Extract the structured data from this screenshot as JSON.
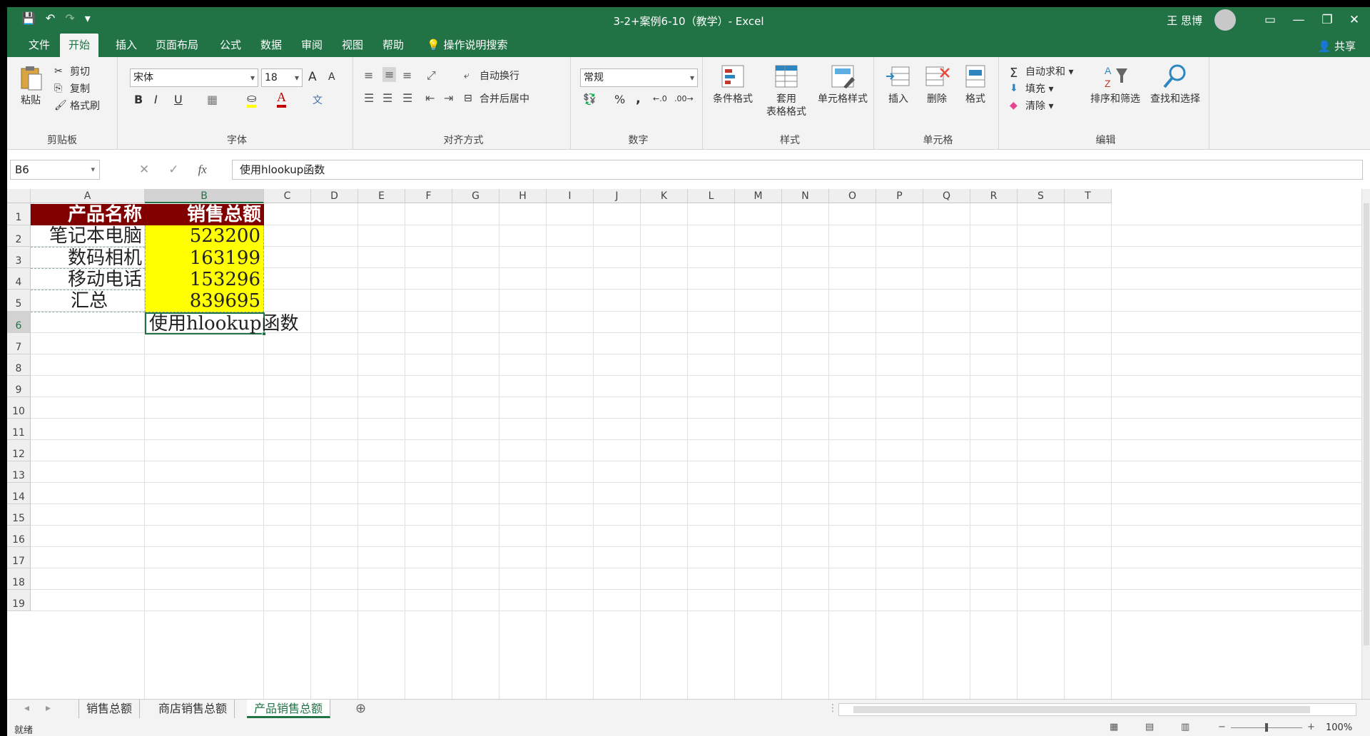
{
  "titlebar": {
    "title": "3-2+案例6-10（教学）- Excel",
    "user": "王 思博",
    "qat": {
      "save": "💾",
      "undo": "↶",
      "redo": "↷",
      "more": "▾"
    },
    "controls": {
      "ribbon": "▭",
      "minimize": "—",
      "restore": "❐",
      "close": "✕"
    }
  },
  "tabs": [
    "文件",
    "开始",
    "插入",
    "页面布局",
    "公式",
    "数据",
    "审阅",
    "视图",
    "帮助"
  ],
  "search_label": "操作说明搜索",
  "share_label": "共享",
  "ribbon": {
    "clipboard": {
      "label": "剪贴板",
      "paste": "粘贴",
      "cut": "剪切",
      "copy": "复制",
      "format_painter": "格式刷"
    },
    "font": {
      "label": "字体",
      "font_name": "宋体",
      "font_size": "18",
      "bold": "B",
      "italic": "I",
      "underline": "U",
      "grow": "A",
      "shrink": "A"
    },
    "alignment": {
      "label": "对齐方式",
      "wrap": "自动换行",
      "merge": "合并后居中"
    },
    "number": {
      "label": "数字",
      "format": "常规",
      "percent": "%",
      "comma": ","
    },
    "styles": {
      "label": "样式",
      "conditional": "条件格式",
      "table_line1": "套用",
      "table_line2": "表格格式",
      "cell_styles": "单元格样式"
    },
    "cells": {
      "label": "单元格",
      "insert": "插入",
      "delete": "删除",
      "format": "格式"
    },
    "editing": {
      "label": "编辑",
      "autosum": "自动求和",
      "fill": "填充",
      "clear": "清除",
      "sort": "排序和筛选",
      "find": "查找和选择"
    }
  },
  "formula_bar": {
    "name_box": "B6",
    "formula": "使用hlookup函数"
  },
  "columns": [
    "A",
    "B",
    "C",
    "D",
    "E",
    "F",
    "G",
    "H",
    "I",
    "J",
    "K",
    "L",
    "M",
    "N",
    "O",
    "P",
    "Q",
    "R",
    "S",
    "T"
  ],
  "rows": [
    "1",
    "2",
    "3",
    "4",
    "5",
    "6",
    "7",
    "8",
    "9",
    "10",
    "11",
    "12",
    "13",
    "14",
    "15",
    "16",
    "17",
    "18",
    "19"
  ],
  "cells": {
    "A1": "产品名称",
    "B1": "销售总额",
    "A2": "笔记本电脑",
    "B2": "523200",
    "A3": "数码相机",
    "B3": "163199",
    "A4": "移动电话",
    "B4": "153296",
    "A5": "汇总",
    "B5": "839695",
    "B6": "使用hlookup函数"
  },
  "sheets": [
    "销售总额",
    "商店销售总额",
    "产品销售总额"
  ],
  "active_sheet": "产品销售总额",
  "status": {
    "ready": "就绪",
    "zoom": "100%"
  },
  "colors": {
    "excel_green": "#217346",
    "header_fill": "#800000",
    "highlight": "#ffff00"
  }
}
